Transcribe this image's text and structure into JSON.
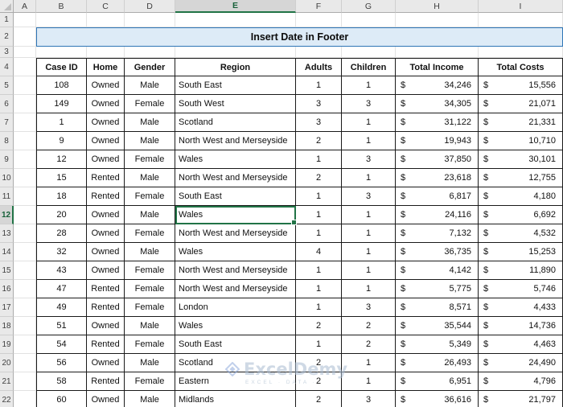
{
  "title": "Insert Date in Footer",
  "currency_symbol": "$",
  "grid": {
    "columns": [
      "A",
      "B",
      "C",
      "D",
      "E",
      "F",
      "G",
      "H",
      "I"
    ],
    "row_numbers": [
      "1",
      "2",
      "3",
      "4",
      "5",
      "6",
      "7",
      "8",
      "9",
      "10",
      "11",
      "12",
      "13",
      "14",
      "15",
      "16",
      "17",
      "18",
      "19",
      "20",
      "21",
      "22"
    ]
  },
  "selection": {
    "cell": "E12",
    "column": "E",
    "row": 12
  },
  "table": {
    "headers": [
      "Case ID",
      "Home",
      "Gender",
      "Region",
      "Adults",
      "Children",
      "Total Income",
      "Total Costs"
    ],
    "rows": [
      {
        "case_id": "108",
        "home": "Owned",
        "gender": "Male",
        "region": "South East",
        "adults": "1",
        "children": "1",
        "income": "34,246",
        "costs": "15,556"
      },
      {
        "case_id": "149",
        "home": "Owned",
        "gender": "Female",
        "region": "South West",
        "adults": "3",
        "children": "3",
        "income": "34,305",
        "costs": "21,071"
      },
      {
        "case_id": "1",
        "home": "Owned",
        "gender": "Male",
        "region": "Scotland",
        "adults": "3",
        "children": "1",
        "income": "31,122",
        "costs": "21,331"
      },
      {
        "case_id": "9",
        "home": "Owned",
        "gender": "Male",
        "region": "North West and Merseyside",
        "adults": "2",
        "children": "1",
        "income": "19,943",
        "costs": "10,710"
      },
      {
        "case_id": "12",
        "home": "Owned",
        "gender": "Female",
        "region": "Wales",
        "adults": "1",
        "children": "3",
        "income": "37,850",
        "costs": "30,101"
      },
      {
        "case_id": "15",
        "home": "Rented",
        "gender": "Male",
        "region": "North West and Merseyside",
        "adults": "2",
        "children": "1",
        "income": "23,618",
        "costs": "12,755"
      },
      {
        "case_id": "18",
        "home": "Rented",
        "gender": "Female",
        "region": "South East",
        "adults": "1",
        "children": "3",
        "income": "6,817",
        "costs": "4,180"
      },
      {
        "case_id": "20",
        "home": "Owned",
        "gender": "Male",
        "region": "Wales",
        "adults": "1",
        "children": "1",
        "income": "24,116",
        "costs": "6,692"
      },
      {
        "case_id": "28",
        "home": "Owned",
        "gender": "Female",
        "region": "North West and Merseyside",
        "adults": "1",
        "children": "1",
        "income": "7,132",
        "costs": "4,532"
      },
      {
        "case_id": "32",
        "home": "Owned",
        "gender": "Male",
        "region": "Wales",
        "adults": "4",
        "children": "1",
        "income": "36,735",
        "costs": "15,253"
      },
      {
        "case_id": "43",
        "home": "Owned",
        "gender": "Female",
        "region": "North West and Merseyside",
        "adults": "1",
        "children": "1",
        "income": "4,142",
        "costs": "11,890"
      },
      {
        "case_id": "47",
        "home": "Rented",
        "gender": "Female",
        "region": "North West and Merseyside",
        "adults": "1",
        "children": "1",
        "income": "5,775",
        "costs": "5,746"
      },
      {
        "case_id": "49",
        "home": "Rented",
        "gender": "Female",
        "region": "London",
        "adults": "1",
        "children": "3",
        "income": "8,571",
        "costs": "4,433"
      },
      {
        "case_id": "51",
        "home": "Owned",
        "gender": "Male",
        "region": "Wales",
        "adults": "2",
        "children": "2",
        "income": "35,544",
        "costs": "14,736"
      },
      {
        "case_id": "54",
        "home": "Rented",
        "gender": "Female",
        "region": "South East",
        "adults": "1",
        "children": "2",
        "income": "5,349",
        "costs": "4,463"
      },
      {
        "case_id": "56",
        "home": "Owned",
        "gender": "Male",
        "region": "Scotland",
        "adults": "2",
        "children": "1",
        "income": "26,493",
        "costs": "24,490"
      },
      {
        "case_id": "58",
        "home": "Rented",
        "gender": "Female",
        "region": "Eastern",
        "adults": "2",
        "children": "1",
        "income": "6,951",
        "costs": "4,796"
      },
      {
        "case_id": "60",
        "home": "Owned",
        "gender": "Male",
        "region": "Midlands",
        "adults": "2",
        "children": "3",
        "income": "36,616",
        "costs": "21,797"
      }
    ]
  },
  "watermark": {
    "brand": "ExcelDemy",
    "tagline": "EXCEL · DATA ·"
  },
  "colors": {
    "accent_green": "#217346",
    "banner_fill": "#DDEBF7",
    "banner_border": "#2E75B6",
    "table_border": "#1a1a1a",
    "header_fill": "#E9E9E9"
  }
}
